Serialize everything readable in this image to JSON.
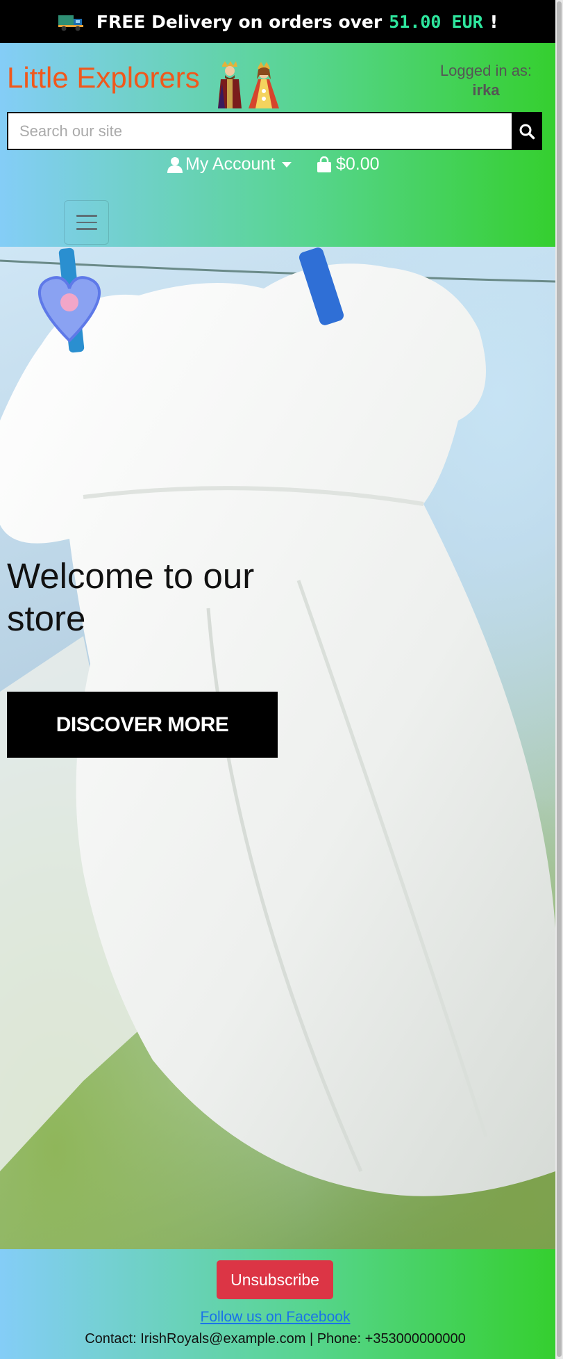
{
  "banner": {
    "text_before": "FREE Delivery on orders over",
    "amount": "51.00 EUR",
    "text_after": "!",
    "icon": "delivery-truck-icon"
  },
  "header": {
    "brand": "Little Explorers",
    "brand_icon": "royal-couple-icon",
    "logged_in_label": "Logged in as:",
    "username": "irka",
    "search_placeholder": "Search our site",
    "search_value": "",
    "account_label": "My Account",
    "bag_total": "$0.00"
  },
  "hero": {
    "title": "Welcome to our store",
    "cta_label": "DISCOVER MORE"
  },
  "footer": {
    "unsubscribe_label": "Unsubscribe",
    "facebook_link": "Follow us on Facebook",
    "contact": "Contact: IrishRoyals@example.com | Phone: +353000000000"
  },
  "colors": {
    "brand": "#f0581c",
    "banner_amount": "#2ee59d",
    "header_gradient_start": "#84cdf7",
    "header_gradient_end": "#35cf2f",
    "unsubscribe": "#dc3545"
  }
}
